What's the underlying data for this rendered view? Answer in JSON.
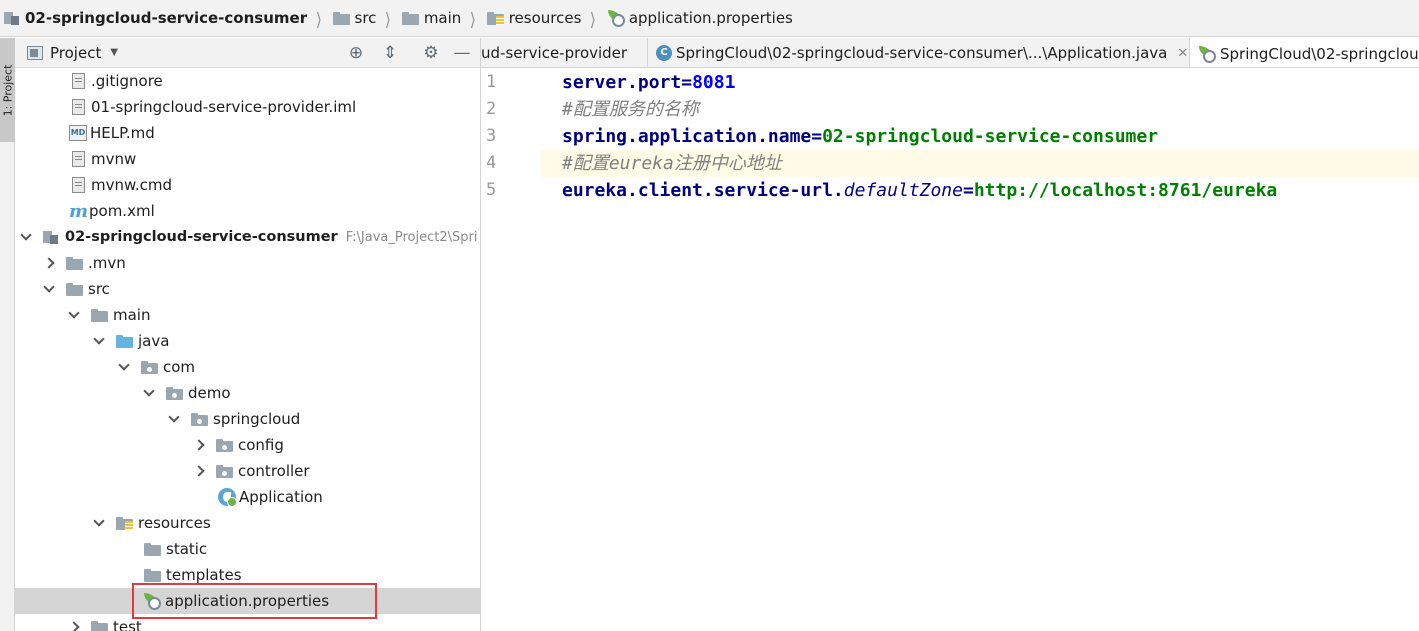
{
  "breadcrumb": {
    "items": [
      "02-springcloud-service-consumer",
      "src",
      "main",
      "resources",
      "application.properties"
    ]
  },
  "tool_stripe": {
    "label": "1: Project"
  },
  "project_panel": {
    "title": "Project",
    "tree": [
      {
        "label": ".gitignore",
        "path": ""
      },
      {
        "label": "01-springcloud-service-provider.iml",
        "path": ""
      },
      {
        "label": "HELP.md",
        "path": ""
      },
      {
        "label": "mvnw",
        "path": ""
      },
      {
        "label": "mvnw.cmd",
        "path": ""
      },
      {
        "label": "pom.xml",
        "path": ""
      },
      {
        "label": "02-springcloud-service-consumer",
        "path": "F:\\Java_Project2\\Spri"
      },
      {
        "label": ".mvn",
        "path": ""
      },
      {
        "label": "src",
        "path": ""
      },
      {
        "label": "main",
        "path": ""
      },
      {
        "label": "java",
        "path": ""
      },
      {
        "label": "com",
        "path": ""
      },
      {
        "label": "demo",
        "path": ""
      },
      {
        "label": "springcloud",
        "path": ""
      },
      {
        "label": "config",
        "path": ""
      },
      {
        "label": "controller",
        "path": ""
      },
      {
        "label": "Application",
        "path": ""
      },
      {
        "label": "resources",
        "path": ""
      },
      {
        "label": "static",
        "path": ""
      },
      {
        "label": "templates",
        "path": ""
      },
      {
        "label": "application.properties",
        "path": ""
      },
      {
        "label": "test",
        "path": ""
      }
    ]
  },
  "editor": {
    "tabs": [
      {
        "label": "ud-service-provider"
      },
      {
        "label": "SpringCloud\\02-springcloud-service-consumer\\...\\Application.java"
      },
      {
        "label": "SpringCloud\\02-springclou"
      }
    ],
    "line_numbers": [
      "1",
      "2",
      "3",
      "4",
      "5"
    ],
    "lines": [
      {
        "key": "server.port",
        "eq": "=",
        "value": "8081"
      },
      {
        "comment": "#配置服务的名称"
      },
      {
        "key": "spring.application.name",
        "eq": "=",
        "value": "02-springcloud-service-consumer"
      },
      {
        "comment": "#配置eureka注册中心地址"
      },
      {
        "key": "eureka.client.service-url.",
        "key_italic": "defaultZone",
        "eq": "=",
        "value": "http://localhost:8761/eureka"
      }
    ]
  },
  "colors": {
    "key": "#000080",
    "value": "#008000",
    "number": "#0000ff",
    "comment": "#808080",
    "selection_outline": "#e0393e",
    "current_line": "#fffbe6"
  }
}
